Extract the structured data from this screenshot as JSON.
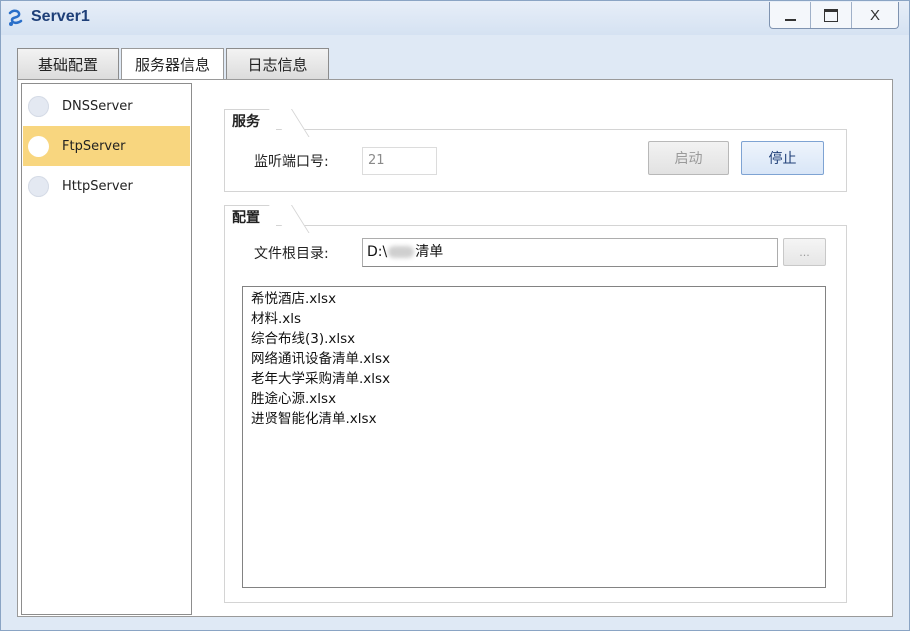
{
  "window": {
    "title": "Server1"
  },
  "title_buttons": {
    "minimize": "minimize",
    "maximize": "maximize",
    "close_label": "X"
  },
  "tabs": [
    {
      "label": "基础配置"
    },
    {
      "label": "服务器信息"
    },
    {
      "label": "日志信息"
    }
  ],
  "sidebar": {
    "items": [
      {
        "label": "DNSServer",
        "selected": false
      },
      {
        "label": "FtpServer",
        "selected": true
      },
      {
        "label": "HttpServer",
        "selected": false
      }
    ]
  },
  "service": {
    "group_title": "服务",
    "port_label": "监听端口号:",
    "port_value": "21",
    "start_label": "启动",
    "stop_label": "停止"
  },
  "config": {
    "group_title": "配置",
    "root_label": "文件根目录:",
    "root_prefix": "D:\\",
    "root_suffix": "清单",
    "browse_label": "...",
    "files": [
      "希悦酒店.xlsx",
      "材料.xls",
      "综合布线(3).xlsx",
      "网络通讯设备清单.xlsx",
      "老年大学采购清单.xlsx",
      "胜途心源.xlsx",
      "进贤智能化清单.xlsx"
    ]
  },
  "colors": {
    "selected_item": "#f8d67f",
    "title_text": "#1e3f78",
    "window_border": "#8aa4c4"
  }
}
